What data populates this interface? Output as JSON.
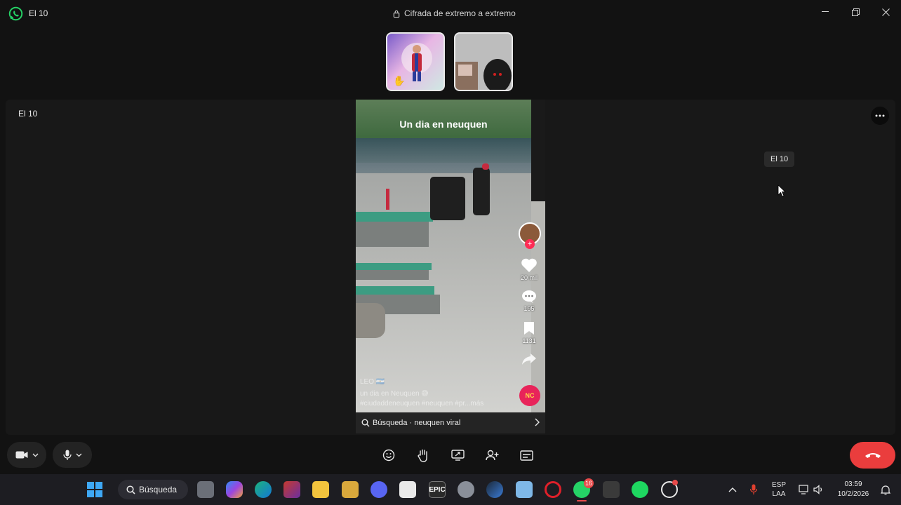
{
  "window": {
    "app_icon": "whatsapp-icon",
    "title": "El 10",
    "encryption_label": "Cifrada de extremo a extremo"
  },
  "stage": {
    "participant_name": "El 10",
    "tooltip": "El 10"
  },
  "shared_video": {
    "overlay_title": "Un dia en neuquen",
    "likes": "20 mil",
    "comments": "195",
    "saves": "1131",
    "shares": "",
    "caption_user": "LEO 🇦🇷",
    "caption_text": "un dia en Neuquen 😅",
    "caption_tags": "#ciudaddeneuquen #neuquen #pr...más",
    "music_label": "NC",
    "search_text": "Búsqueda · neuquen viral"
  },
  "controls": {
    "camera": "video-camera-icon",
    "mic": "microphone-icon",
    "center": [
      "emoji-icon",
      "raise-hand-icon",
      "share-screen-icon",
      "add-participant-icon",
      "captions-icon"
    ],
    "end_call": "end-call-icon",
    "end_call_color": "#ea3d3d"
  },
  "taskbar": {
    "search_label": "Búsqueda",
    "whatsapp_badge": "16",
    "tray": {
      "language_line1": "ESP",
      "language_line2": "LAA",
      "time": "03:59",
      "date": "10/2/2026"
    }
  },
  "colors": {
    "background": "#121212",
    "stage": "#181818",
    "whatsapp_green": "#25d366",
    "tiktok_red": "#fe2c55"
  }
}
